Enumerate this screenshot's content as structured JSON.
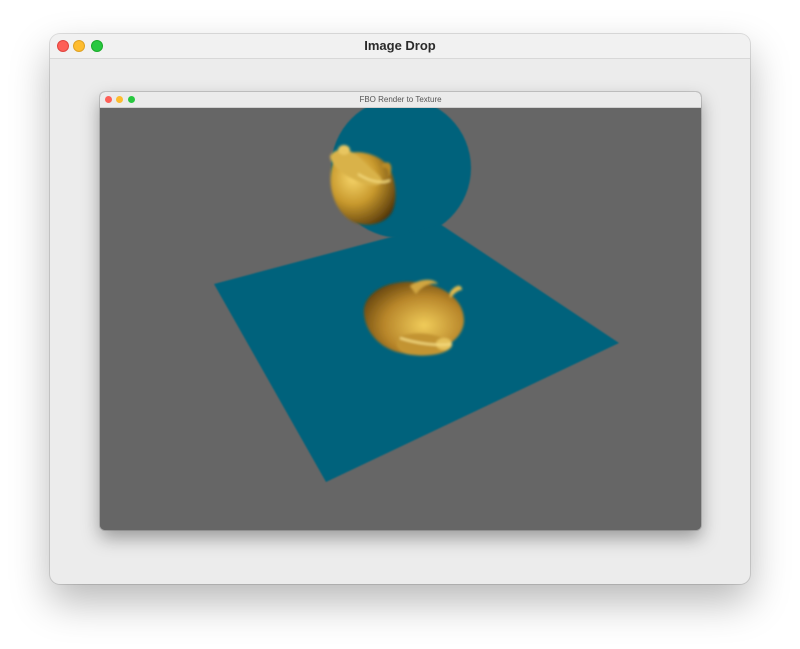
{
  "outer_window": {
    "title": "Image Drop"
  },
  "inner_window": {
    "title": "FBO Render to Texture"
  },
  "scene": {
    "background_color": "#666666",
    "surface_color": "#00627c",
    "object_color": "#c8a034",
    "objects": [
      "teapot-reflection",
      "teapot"
    ]
  }
}
